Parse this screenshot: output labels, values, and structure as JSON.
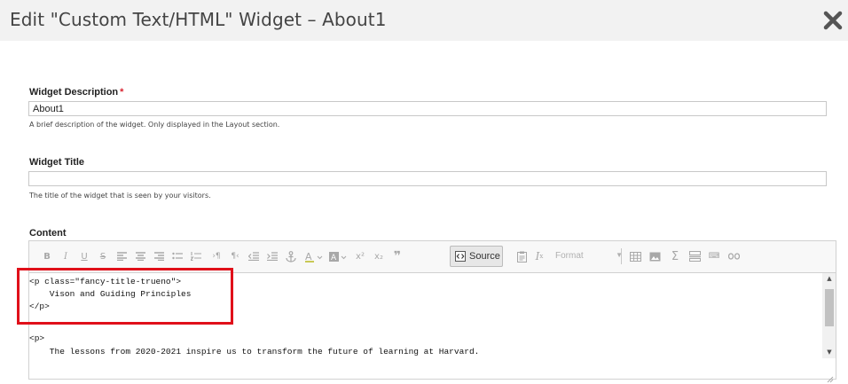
{
  "dialog": {
    "title": "Edit \"Custom Text/HTML\" Widget – About1",
    "close_icon": "close-x-icon"
  },
  "form": {
    "description": {
      "label": "Widget Description",
      "required_mark": "*",
      "value": "About1",
      "help": "A brief description of the widget. Only displayed in the Layout section."
    },
    "title": {
      "label": "Widget Title",
      "value": "",
      "help": "The title of the widget that is seen by your visitors."
    },
    "content": {
      "label": "Content"
    }
  },
  "editor": {
    "toolbar": {
      "bold": "B",
      "italic": "I",
      "underline": "U",
      "strike": "S",
      "source_label": "Source",
      "format_label": "Format",
      "icons": [
        "align-left-icon",
        "align-center-icon",
        "align-right-icon",
        "bulleted-list-icon",
        "numbered-list-icon",
        "ltr-icon",
        "rtl-icon",
        "outdent-icon",
        "indent-icon",
        "anchor-icon",
        "text-color-icon",
        "bg-color-icon",
        "superscript-icon",
        "subscript-icon",
        "blockquote-icon",
        "paste-text-icon",
        "remove-format-icon",
        "table-icon",
        "image-icon",
        "math-icon",
        "horizontal-rule-icon",
        "special-char-icon",
        "unlink-icon"
      ]
    },
    "code_lines": [
      "<p class=\"fancy-title-trueno\">",
      "    Vison and Guiding Principles",
      "</p>",
      "",
      "<p>",
      "    The lessons from 2020-2021 inspire us to transform the future of learning at Harvard."
    ]
  },
  "colors": {
    "header_bg": "#f2f2f2",
    "required": "#d9232f",
    "highlight": "#e0101a"
  }
}
